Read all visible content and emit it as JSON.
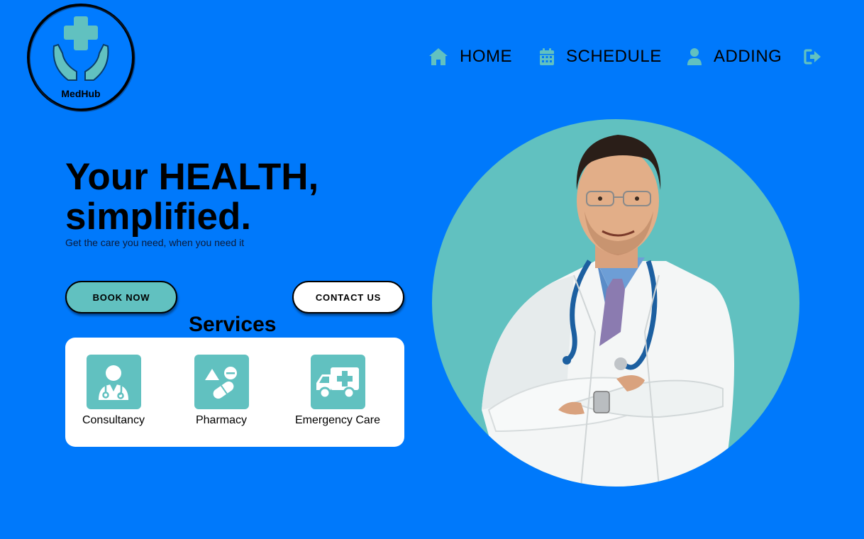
{
  "brand": {
    "name": "MedHub"
  },
  "nav": {
    "items": [
      {
        "label": "HOME",
        "icon": "home-icon"
      },
      {
        "label": "SCHEDULE",
        "icon": "calendar-icon"
      },
      {
        "label": "ADDING",
        "icon": "user-icon"
      }
    ],
    "logout_icon": "logout-icon"
  },
  "hero": {
    "title_line1": "Your HEALTH,",
    "title_line2": "simplified.",
    "subtitle": "Get the care you need, when you need it",
    "book_label": "BOOK NOW",
    "contact_label": "CONTACT US"
  },
  "services": {
    "title": "Services",
    "items": [
      {
        "label": "Consultancy",
        "icon": "doctor-icon"
      },
      {
        "label": "Pharmacy",
        "icon": "pills-icon"
      },
      {
        "label": "Emergency Care",
        "icon": "ambulance-icon"
      }
    ]
  },
  "colors": {
    "background": "#0079fb",
    "accent": "#61c1c0",
    "card": "#ffffff",
    "text": "#000000"
  }
}
